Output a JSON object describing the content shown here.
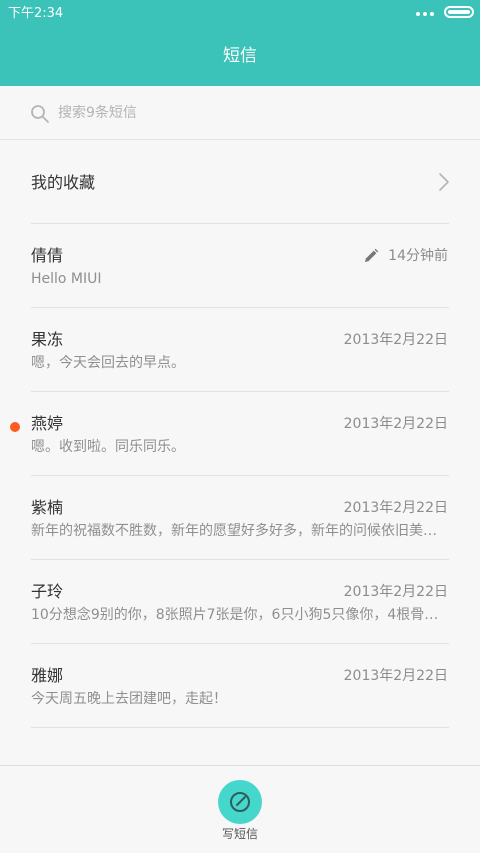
{
  "status_bar": {
    "time": "下午2:34",
    "signal_icon": "more-dots-icon",
    "battery_icon": "battery-icon"
  },
  "header": {
    "title": "短信",
    "color": "#3cc3b9"
  },
  "search": {
    "placeholder": "搜索9条短信",
    "icon": "search-icon"
  },
  "favorites": {
    "label": "我的收藏",
    "icon": "chevron-right-icon"
  },
  "conversations": [
    {
      "name": "倩倩",
      "preview": "Hello MIUI",
      "time": "14分钟前",
      "draft": true,
      "unread": false
    },
    {
      "name": "果冻",
      "preview": "嗯，今天会回去的早点。",
      "time": "2013年2月22日",
      "draft": false,
      "unread": false
    },
    {
      "name": "燕婷",
      "preview": "嗯。收到啦。同乐同乐。",
      "time": "2013年2月22日",
      "draft": false,
      "unread": true
    },
    {
      "name": "紫楠",
      "preview": "新年的祝福数不胜数，新年的愿望好多好多，新年的问候依旧美…",
      "time": "2013年2月22日",
      "draft": false,
      "unread": false
    },
    {
      "name": "子玲",
      "preview": "10分想念9别的你，8张照片7张是你，6只小狗5只像你，4根骨…",
      "time": "2013年2月22日",
      "draft": false,
      "unread": false
    },
    {
      "name": "雅娜",
      "preview": "今天周五晚上去团建吧，走起！",
      "time": "2013年2月22日",
      "draft": false,
      "unread": false
    }
  ],
  "compose": {
    "label": "写短信",
    "icon": "compose-icon",
    "color": "#45d6cc"
  },
  "colors": {
    "unread_dot": "#ff5a1f"
  }
}
